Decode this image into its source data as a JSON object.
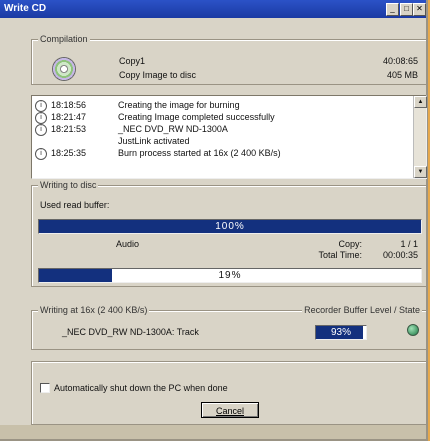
{
  "window": {
    "title": "Write CD"
  },
  "compilation": {
    "label": "Compilation",
    "name": "Copy1",
    "action": "Copy Image to disc",
    "duration": "40:08:65",
    "size": "405 MB"
  },
  "log": {
    "rows": [
      {
        "time": "18:18:56",
        "msg": "Creating the image for burning"
      },
      {
        "time": "18:21:47",
        "msg": "Creating Image completed successfully"
      },
      {
        "time": "18:21:53",
        "msg": "_NEC DVD_RW ND-1300A"
      },
      {
        "time": "",
        "msg": "JustLink activated"
      },
      {
        "time": "18:25:35",
        "msg": "Burn process started at 16x (2 400 KB/s)"
      }
    ]
  },
  "writing": {
    "label": "Writing to disc",
    "read_buffer_label": "Used read buffer:",
    "read_buffer_value": "100%",
    "read_buffer_fraction": 1.0,
    "track_type": "Audio",
    "copy_label": "Copy:",
    "copy_value": "1 / 1",
    "total_time_label": "Total Time:",
    "total_time_value": "00:00:35",
    "progress_value": "19%",
    "progress_fraction": 0.19
  },
  "recorder": {
    "label": "Writing at 16x (2 400 KB/s)",
    "buffer_label": "Recorder Buffer Level / State",
    "device": "_NEC DVD_RW ND-1300A: Track",
    "buffer_value": "93%",
    "buffer_fraction": 0.93,
    "state_color": "#1c7a44"
  },
  "options": {
    "shutdown_label": "Automatically shut down the PC when done",
    "shutdown_checked": false
  },
  "buttons": {
    "cancel": "Cancel"
  },
  "colors": {
    "title_bar": "#2b52c7",
    "progress_fill": "#13307e"
  }
}
